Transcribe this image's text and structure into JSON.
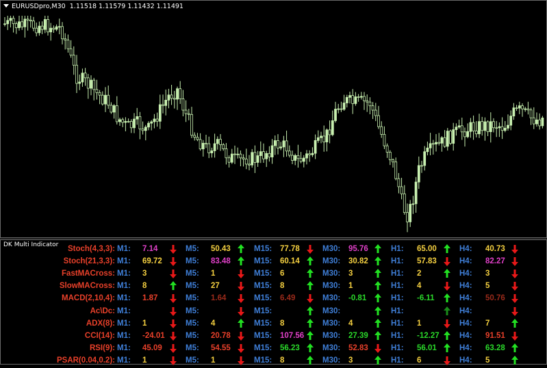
{
  "chart": {
    "symbol": "EURUSDpro,M30",
    "ohlc": "1.11518 1.11579 1.11432 1.11491",
    "candle_color": "#c8f0b0"
  },
  "indicator_panel": {
    "title": "DK Multi Indicator",
    "timeframes": [
      "M1:",
      "M5:",
      "M15:",
      "M30:",
      "H1:",
      "H4:"
    ],
    "rows": [
      {
        "label": "Stoch(4,3,3):",
        "cells": [
          {
            "v": "7.14",
            "c": "#e040c8",
            "a": "down"
          },
          {
            "v": "50.43",
            "c": "#f5d040",
            "a": "up"
          },
          {
            "v": "77.78",
            "c": "#f5d040",
            "a": "down"
          },
          {
            "v": "95.76",
            "c": "#e040c8",
            "a": "up"
          },
          {
            "v": "65.00",
            "c": "#f5d040",
            "a": "up"
          },
          {
            "v": "40.73",
            "c": "#f5d040",
            "a": "down"
          }
        ]
      },
      {
        "label": "Stoch(21,3,3):",
        "cells": [
          {
            "v": "69.72",
            "c": "#f5d040",
            "a": "down"
          },
          {
            "v": "83.48",
            "c": "#e040c8",
            "a": "up"
          },
          {
            "v": "60.14",
            "c": "#f5d040",
            "a": "up"
          },
          {
            "v": "30.82",
            "c": "#f5d040",
            "a": "up"
          },
          {
            "v": "57.83",
            "c": "#f5d040",
            "a": "down"
          },
          {
            "v": "82.27",
            "c": "#e040c8",
            "a": "down"
          }
        ]
      },
      {
        "label": "FastMACross:",
        "cells": [
          {
            "v": "3",
            "c": "#f5d040",
            "a": "down"
          },
          {
            "v": "1",
            "c": "#f5d040",
            "a": "down"
          },
          {
            "v": "6",
            "c": "#f5d040",
            "a": "up"
          },
          {
            "v": "3",
            "c": "#f5d040",
            "a": "up"
          },
          {
            "v": "2",
            "c": "#f5d040",
            "a": "up"
          },
          {
            "v": "3",
            "c": "#f5d040",
            "a": "down"
          }
        ]
      },
      {
        "label": "SlowMACross:",
        "cells": [
          {
            "v": "8",
            "c": "#f5d040",
            "a": "up"
          },
          {
            "v": "27",
            "c": "#f5d040",
            "a": "down"
          },
          {
            "v": "8",
            "c": "#f5d040",
            "a": "up"
          },
          {
            "v": "1",
            "c": "#f5d040",
            "a": "up"
          },
          {
            "v": "4",
            "c": "#f5d040",
            "a": "down"
          },
          {
            "v": "5",
            "c": "#f5d040",
            "a": "down"
          }
        ]
      },
      {
        "label": "MACD(2,10,4):",
        "cells": [
          {
            "v": "1.87",
            "c": "#e8402a",
            "a": "down"
          },
          {
            "v": "1.64",
            "c": "#9a2a1a",
            "a": "down"
          },
          {
            "v": "6.49",
            "c": "#9a2a1a",
            "a": "down"
          },
          {
            "v": "-0.81",
            "c": "#2ad82a",
            "a": "up"
          },
          {
            "v": "-6.11",
            "c": "#2ad82a",
            "a": "up"
          },
          {
            "v": "50.76",
            "c": "#9a2a1a",
            "a": "down"
          }
        ]
      },
      {
        "label": "Ac\\Dc:",
        "cells": [
          {
            "v": "",
            "c": "#f5d040",
            "a": "down"
          },
          {
            "v": "",
            "c": "#f5d040",
            "a": "down"
          },
          {
            "v": "",
            "c": "#f5d040",
            "a": "up"
          },
          {
            "v": "",
            "c": "#f5d040",
            "a": "up"
          },
          {
            "v": "",
            "c": "#f5d040",
            "a": "updark"
          },
          {
            "v": "",
            "c": "#f5d040",
            "a": "down"
          }
        ]
      },
      {
        "label": "ADX(8):",
        "cells": [
          {
            "v": "1",
            "c": "#f5d040",
            "a": "down"
          },
          {
            "v": "4",
            "c": "#f5d040",
            "a": "up"
          },
          {
            "v": "8",
            "c": "#f5d040",
            "a": "up"
          },
          {
            "v": "4",
            "c": "#f5d040",
            "a": "up"
          },
          {
            "v": "1",
            "c": "#f5d040",
            "a": "down"
          },
          {
            "v": "7",
            "c": "#f5d040",
            "a": "up"
          }
        ]
      },
      {
        "label": "CCI(14):",
        "cells": [
          {
            "v": "-24.01",
            "c": "#e8402a",
            "a": "down"
          },
          {
            "v": "20.78",
            "c": "#e8402a",
            "a": "down"
          },
          {
            "v": "107.56",
            "c": "#e040c8",
            "a": "up"
          },
          {
            "v": "27.39",
            "c": "#2ad82a",
            "a": "up"
          },
          {
            "v": "-12.27",
            "c": "#2ad82a",
            "a": "up"
          },
          {
            "v": "91.51",
            "c": "#e8402a",
            "a": "down"
          }
        ]
      },
      {
        "label": "RSI(9):",
        "cells": [
          {
            "v": "45.09",
            "c": "#e8402a",
            "a": "down"
          },
          {
            "v": "54.55",
            "c": "#e8402a",
            "a": "down"
          },
          {
            "v": "56.23",
            "c": "#2ad82a",
            "a": "up"
          },
          {
            "v": "52.83",
            "c": "#e8402a",
            "a": "down"
          },
          {
            "v": "56.01",
            "c": "#2ad82a",
            "a": "up"
          },
          {
            "v": "63.28",
            "c": "#2ad82a",
            "a": "up"
          }
        ]
      },
      {
        "label": "PSAR(0.04,0.2):",
        "cells": [
          {
            "v": "1",
            "c": "#f5d040",
            "a": "down"
          },
          {
            "v": "1",
            "c": "#f5d040",
            "a": "down"
          },
          {
            "v": "8",
            "c": "#f5d040",
            "a": "up"
          },
          {
            "v": "3",
            "c": "#f5d040",
            "a": "up"
          },
          {
            "v": "6",
            "c": "#f5d040",
            "a": "down"
          },
          {
            "v": "5",
            "c": "#f5d040",
            "a": "up"
          }
        ]
      }
    ]
  }
}
